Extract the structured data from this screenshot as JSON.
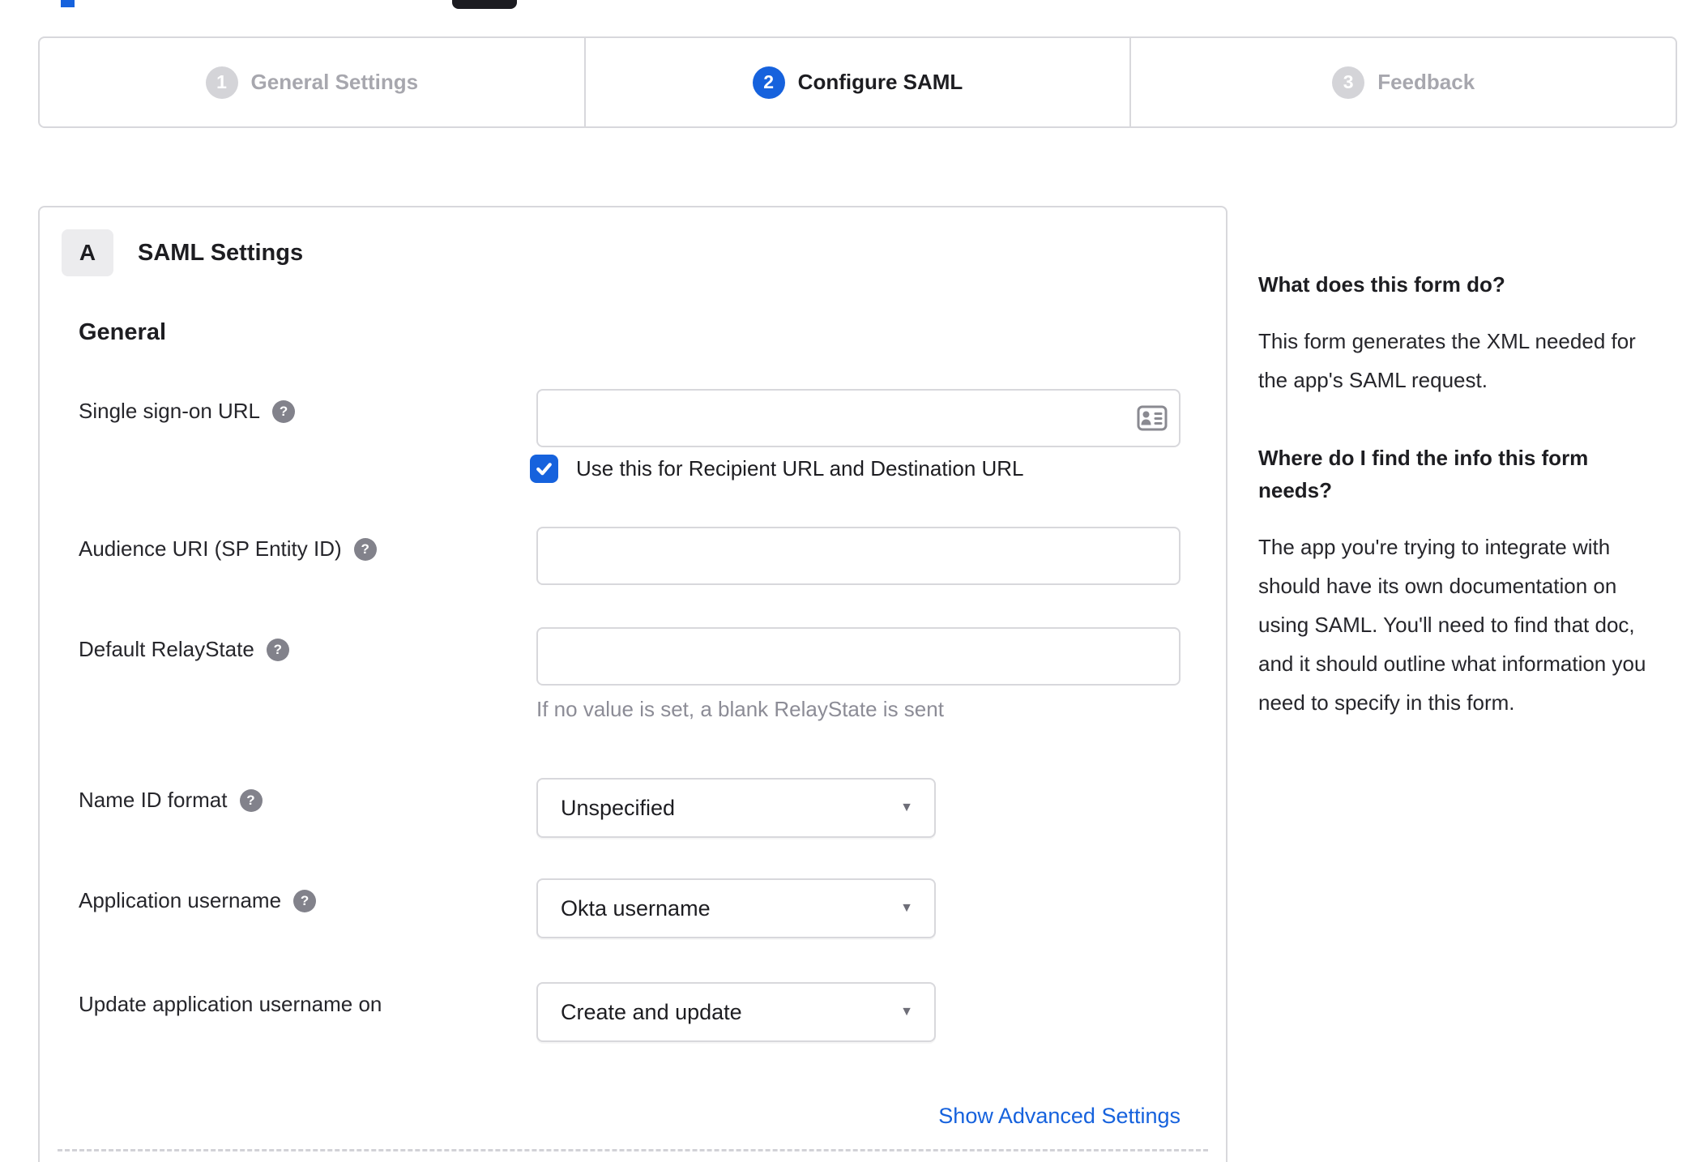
{
  "colors": {
    "accent_blue": "#1662dd",
    "border_gray": "#d8d8dc",
    "text_dark": "#1d1d21",
    "text_muted": "#8c8c96"
  },
  "stepper": {
    "steps": [
      {
        "number": "1",
        "label": "General Settings",
        "state": "inactive"
      },
      {
        "number": "2",
        "label": "Configure SAML",
        "state": "active"
      },
      {
        "number": "3",
        "label": "Feedback",
        "state": "inactive"
      }
    ]
  },
  "panel": {
    "badge": "A",
    "title": "SAML Settings",
    "section_heading": "General"
  },
  "form": {
    "sso": {
      "label": "Single sign-on URL",
      "value": "",
      "checkbox_label": "Use this for Recipient URL and Destination URL",
      "checked": true
    },
    "audience": {
      "label": "Audience URI (SP Entity ID)",
      "value": ""
    },
    "relaystate": {
      "label": "Default RelayState",
      "value": "",
      "hint": "If no value is set, a blank RelayState is sent"
    },
    "nameid": {
      "label": "Name ID format",
      "value": "Unspecified"
    },
    "appusername": {
      "label": "Application username",
      "value": "Okta username"
    },
    "updateusername": {
      "label": "Update application username on",
      "value": "Create and update"
    },
    "advanced_link": "Show Advanced Settings"
  },
  "help": {
    "q1": "What does this form do?",
    "a1": "This form generates the XML needed for the app's SAML request.",
    "q2": "Where do I find the info this form needs?",
    "a2": "The app you're trying to integrate with should have its own documentation on using SAML. You'll need to find that doc, and it should outline what information you need to specify in this form."
  },
  "icons": {
    "help": "?",
    "caret": "▼"
  }
}
